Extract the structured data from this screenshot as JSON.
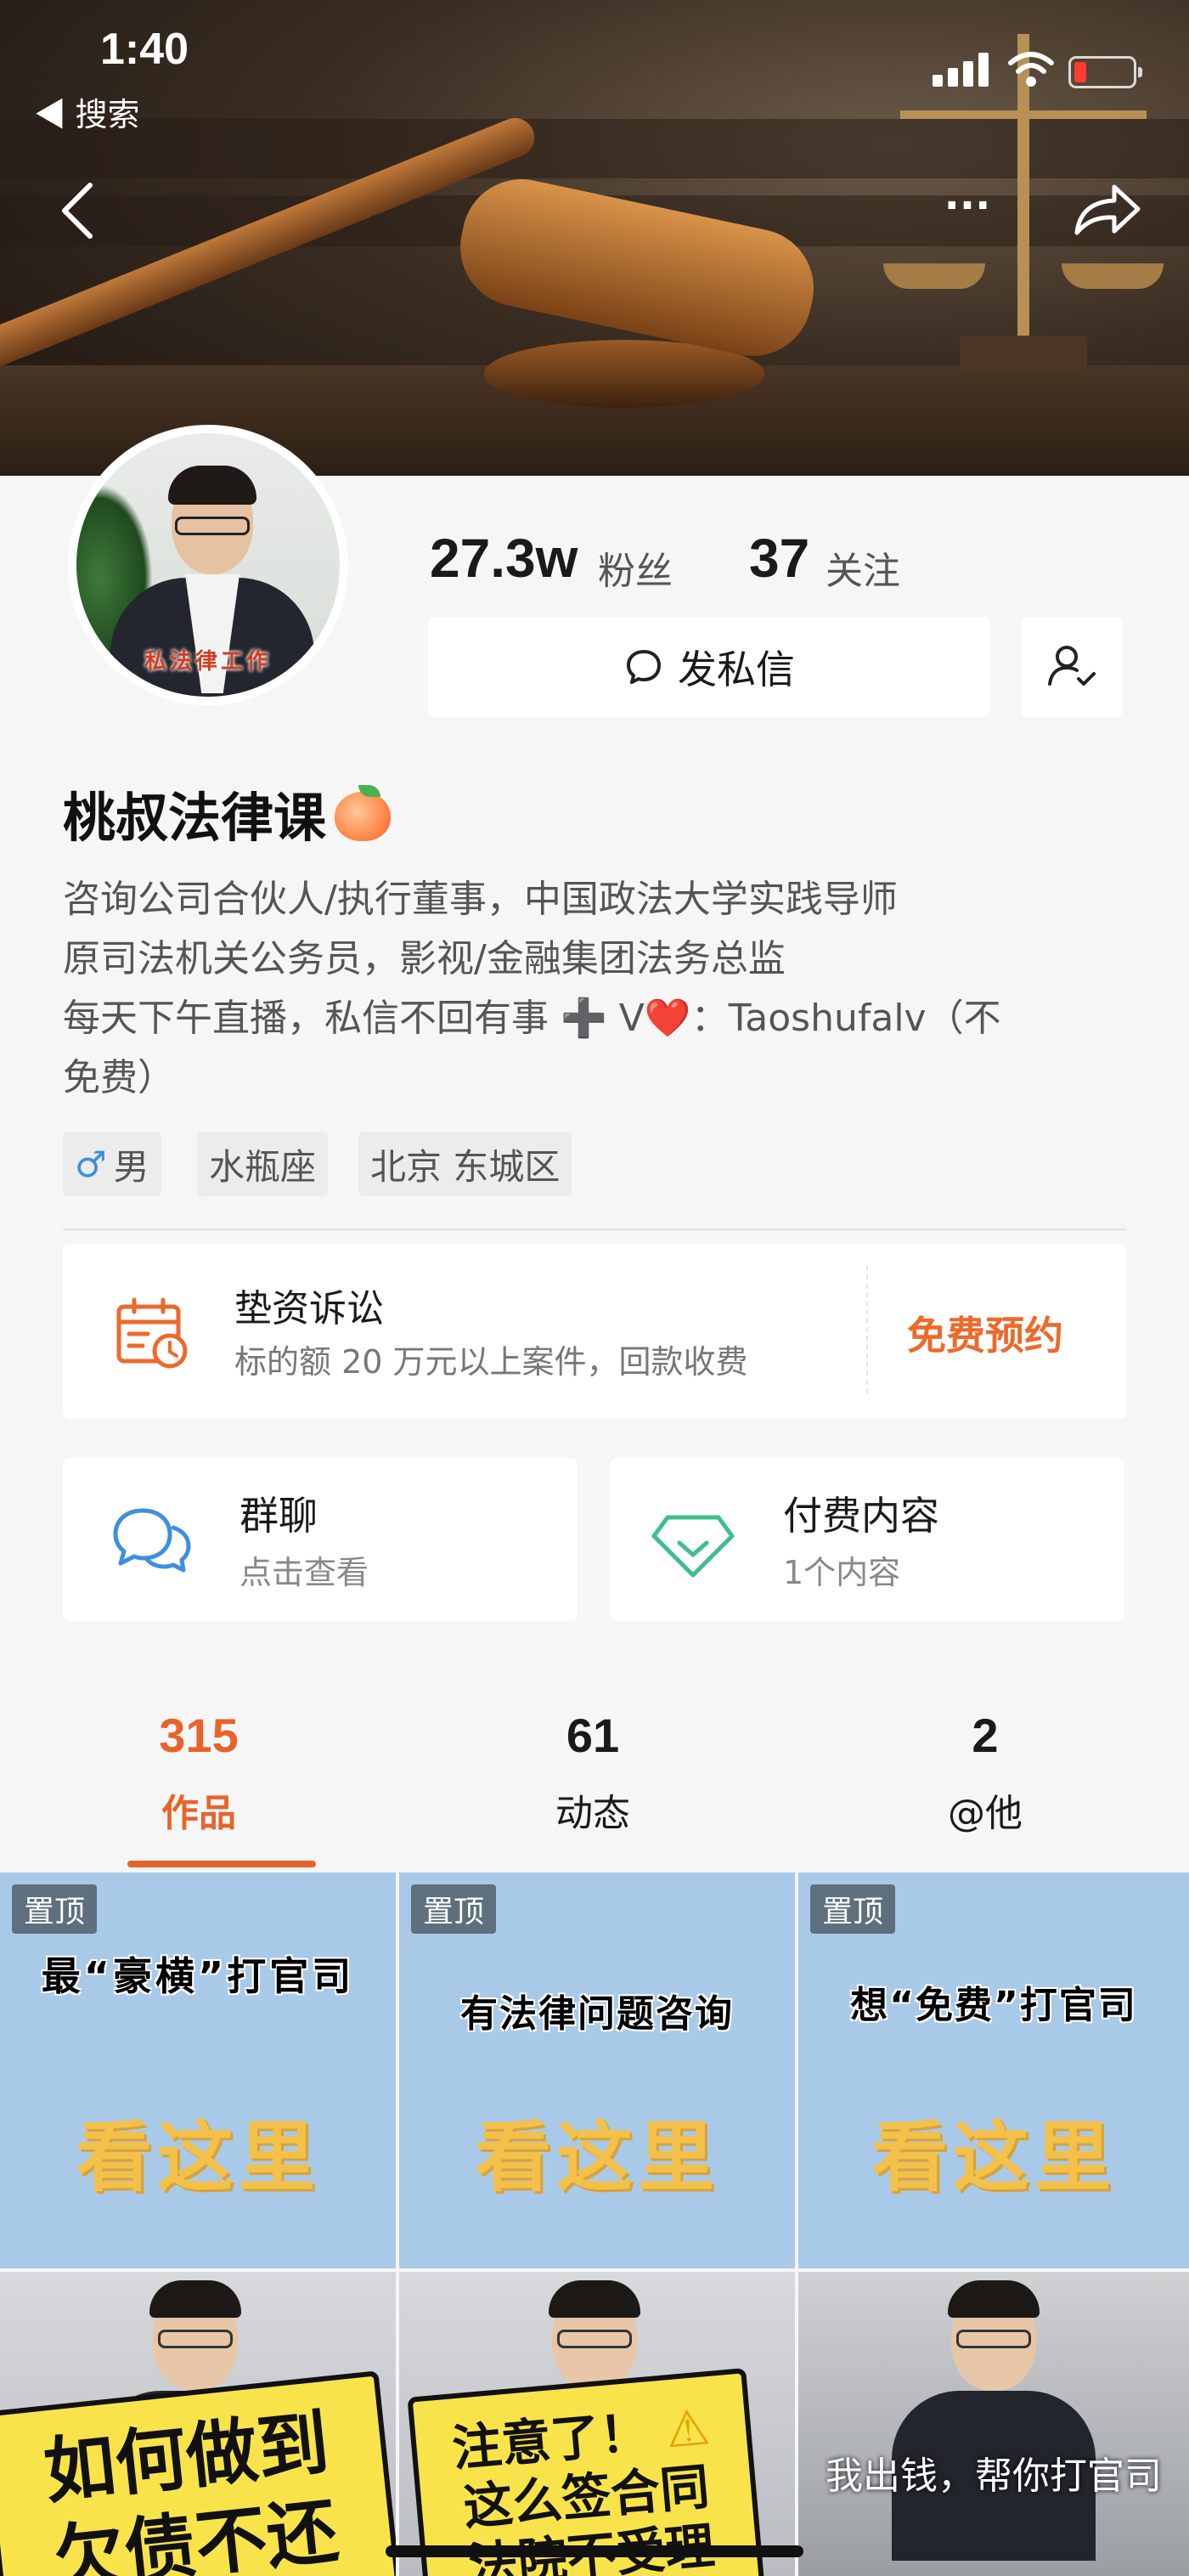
{
  "status_bar": {
    "time": "1:40",
    "back_app": "◀ 搜索"
  },
  "header": {
    "more_label": "···"
  },
  "profile": {
    "avatar_ribbon": "私法律工作",
    "fans_count": "27.3w",
    "fans_label": "粉丝",
    "following_count": "37",
    "following_label": "关注",
    "message_button": "发私信",
    "nickname": "桃叔法律课",
    "bio_line1": "咨询公司合伙人/执行董事，中国政法大学实践导师",
    "bio_line2": "原司法机关公务员，影视/金融集团法务总监",
    "bio_line3_a": "每天下午直播，私信不回有事",
    "bio_line3_plus": "➕",
    "bio_line3_v": " V",
    "bio_line3_heart": "❤️",
    "bio_line3_b": "：Taoshufalv（不",
    "bio_line4": "免费）",
    "tags": {
      "gender": "男",
      "zodiac": "水瓶座",
      "location": "北京 东城区"
    }
  },
  "service": {
    "title": "垫资诉讼",
    "subtitle": "标的额 20 万元以上案件，回款收费",
    "cta": "免费预约"
  },
  "quick_cards": {
    "group": {
      "title": "群聊",
      "subtitle": "点击查看"
    },
    "paid": {
      "title": "付费内容",
      "subtitle": "1个内容"
    }
  },
  "tabs": [
    {
      "count": "315",
      "label": "作品",
      "active": true
    },
    {
      "count": "61",
      "label": "动态",
      "active": false
    },
    {
      "count": "2",
      "label": "@他",
      "active": false
    }
  ],
  "grid": {
    "pinned_badge": "置顶",
    "pinned": [
      {
        "headline": "最“豪横”打官司",
        "look": "看这里"
      },
      {
        "headline": "有法律问题咨询",
        "look": "看这里"
      },
      {
        "headline": "想“免费”打官司",
        "look": "看这里"
      }
    ],
    "videos": [
      {
        "sign_line1": "如何做到",
        "sign_line2": "欠债不还"
      },
      {
        "sign_line1": "注意了！",
        "sign_warn": "⚠",
        "sign_line2": "这么签合同",
        "sign_line3": "法院不受理"
      },
      {
        "caption": "我出钱，帮你打官司"
      }
    ]
  },
  "colors": {
    "accent": "#e8632a",
    "cta": "#ec6a2c",
    "pinned_bg": "#a9c9e9",
    "sign_yellow": "#f8e34a"
  },
  "icons": {
    "back": "chevron-left-icon",
    "more": "more-dots-icon",
    "share": "share-arrow-icon",
    "message": "chat-bubble-icon",
    "follow": "user-check-icon",
    "calendar": "calendar-clock-icon",
    "group_chat": "chat-bubbles-icon",
    "paid": "diamond-icon"
  }
}
